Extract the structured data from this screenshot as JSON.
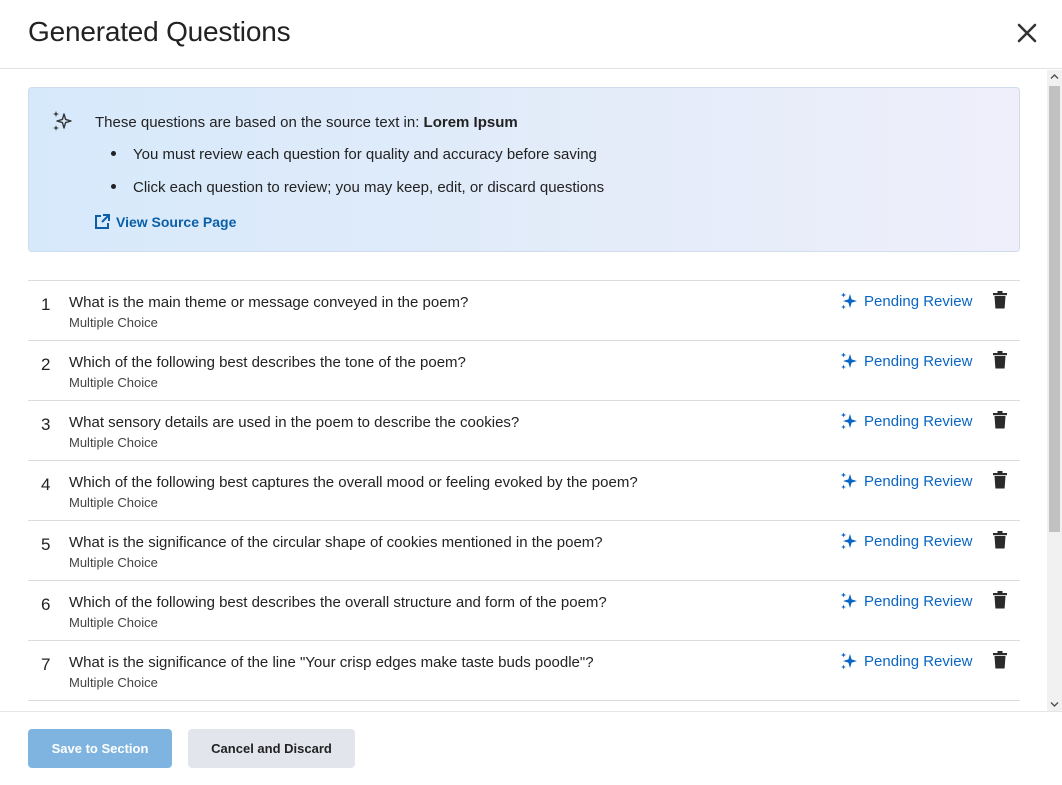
{
  "dialog": {
    "title": "Generated Questions",
    "close_icon": "close-icon"
  },
  "info": {
    "lead_prefix": "These questions are based on the source text in: ",
    "source_name": "Lorem Ipsum",
    "bullets": [
      "You must review each question for quality and accuracy before saving",
      "Click each question to review; you may keep, edit, or discard questions"
    ],
    "view_source_label": "View Source Page",
    "icon": "sparkle-icon",
    "link_icon": "external-link-icon"
  },
  "questions": [
    {
      "number": "1",
      "text": "What is the main theme or message conveyed in the poem?",
      "type": "Multiple Choice",
      "status": "Pending Review"
    },
    {
      "number": "2",
      "text": "Which of the following best describes the tone of the poem?",
      "type": "Multiple Choice",
      "status": "Pending Review"
    },
    {
      "number": "3",
      "text": "What sensory details are used in the poem to describe the cookies?",
      "type": "Multiple Choice",
      "status": "Pending Review"
    },
    {
      "number": "4",
      "text": "Which of the following best captures the overall mood or feeling evoked by the poem?",
      "type": "Multiple Choice",
      "status": "Pending Review"
    },
    {
      "number": "5",
      "text": "What is the significance of the circular shape of cookies mentioned in the poem?",
      "type": "Multiple Choice",
      "status": "Pending Review"
    },
    {
      "number": "6",
      "text": "Which of the following best describes the overall structure and form of the poem?",
      "type": "Multiple Choice",
      "status": "Pending Review"
    },
    {
      "number": "7",
      "text": "What is the significance of the line \"Your crisp edges make taste buds poodle\"?",
      "type": "Multiple Choice",
      "status": "Pending Review"
    }
  ],
  "footer": {
    "save_label": "Save to Section",
    "cancel_label": "Cancel and Discard"
  },
  "colors": {
    "accent": "#0a66c2",
    "save_button": "#7fb4e0",
    "cancel_button": "#e2e6ec"
  }
}
